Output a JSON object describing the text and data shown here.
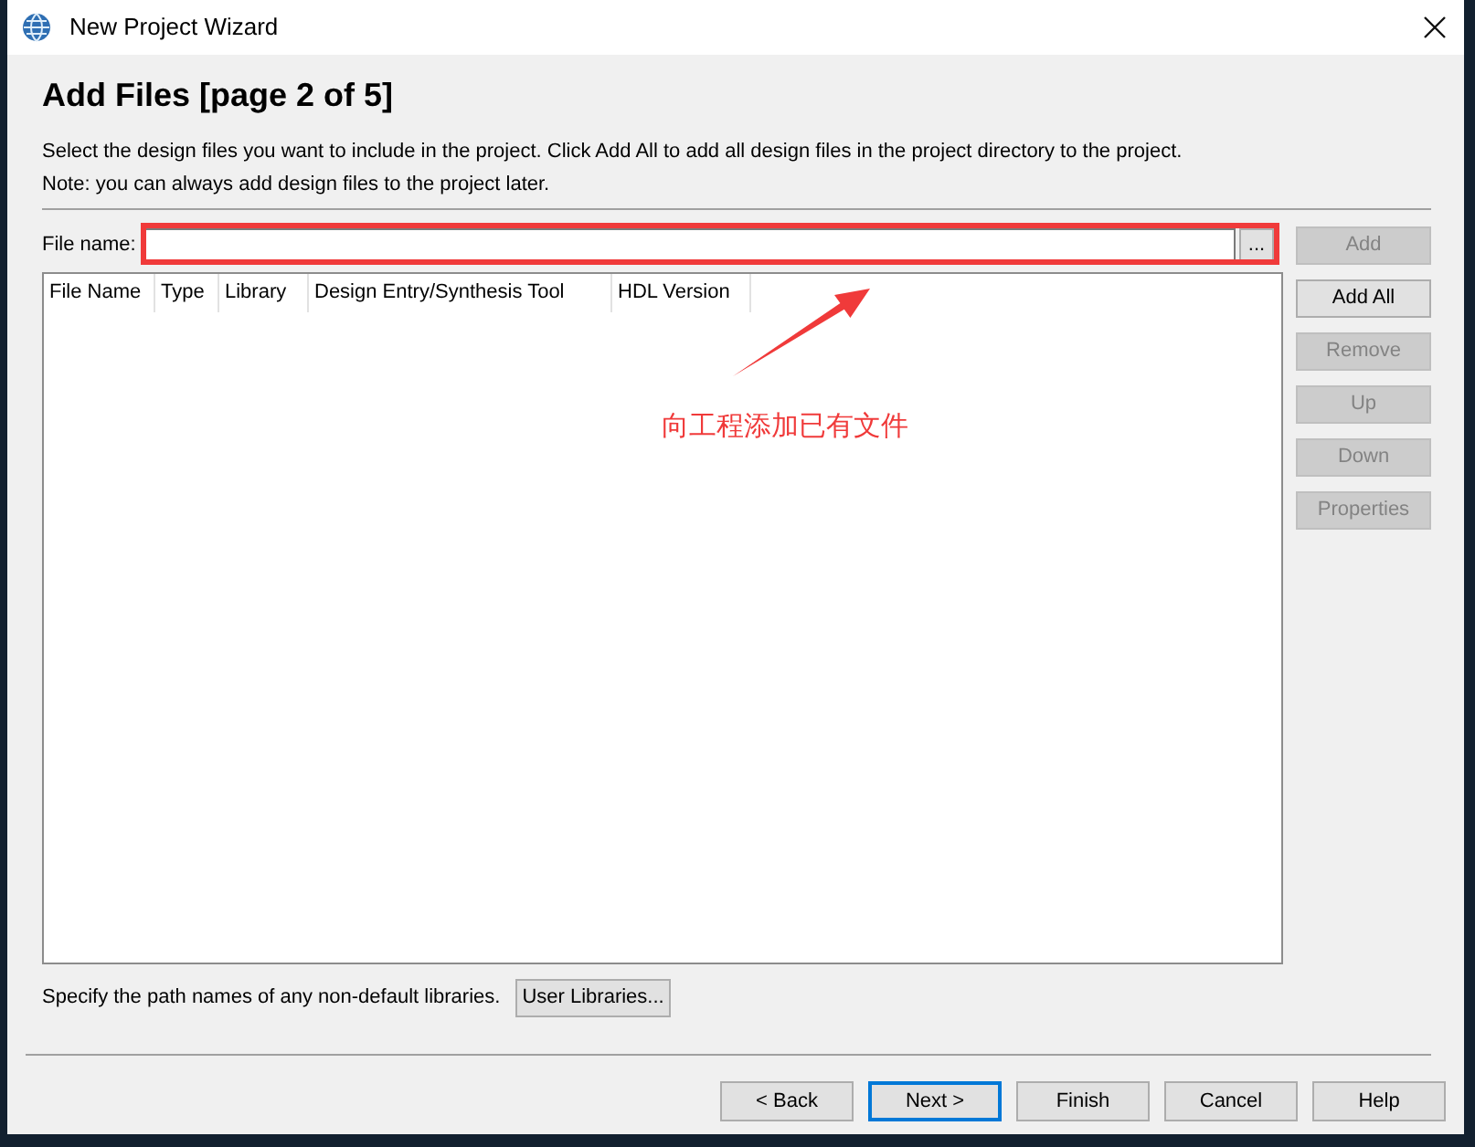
{
  "window": {
    "title": "New Project Wizard"
  },
  "page": {
    "heading": "Add Files [page 2 of 5]",
    "description": [
      "Select the design files you want to include in the project. Click Add All to add all design files in the project directory to the project.",
      "Note: you can always add design files to the project later."
    ]
  },
  "file_name": {
    "label": "File name:",
    "browse_button": "..."
  },
  "table": {
    "columns": [
      "File Name",
      "Type",
      "Library",
      "Design Entry/Synthesis Tool",
      "HDL Version"
    ]
  },
  "side_buttons": [
    {
      "label": "Add",
      "disabled": true
    },
    {
      "label": "Add All",
      "disabled": false
    },
    {
      "label": "Remove",
      "disabled": true
    },
    {
      "label": "Up",
      "disabled": true
    },
    {
      "label": "Down",
      "disabled": true
    },
    {
      "label": "Properties",
      "disabled": true
    }
  ],
  "libraries": {
    "text": "Specify the path names of any non-default libraries.",
    "button": "User Libraries..."
  },
  "nav_buttons": [
    {
      "label": "< Back",
      "focused": false
    },
    {
      "label": "Next >",
      "focused": true
    },
    {
      "label": "Finish",
      "focused": false
    },
    {
      "label": "Cancel",
      "focused": false
    },
    {
      "label": "Help",
      "focused": false
    }
  ],
  "annotation": {
    "text": "向工程添加已有文件"
  }
}
